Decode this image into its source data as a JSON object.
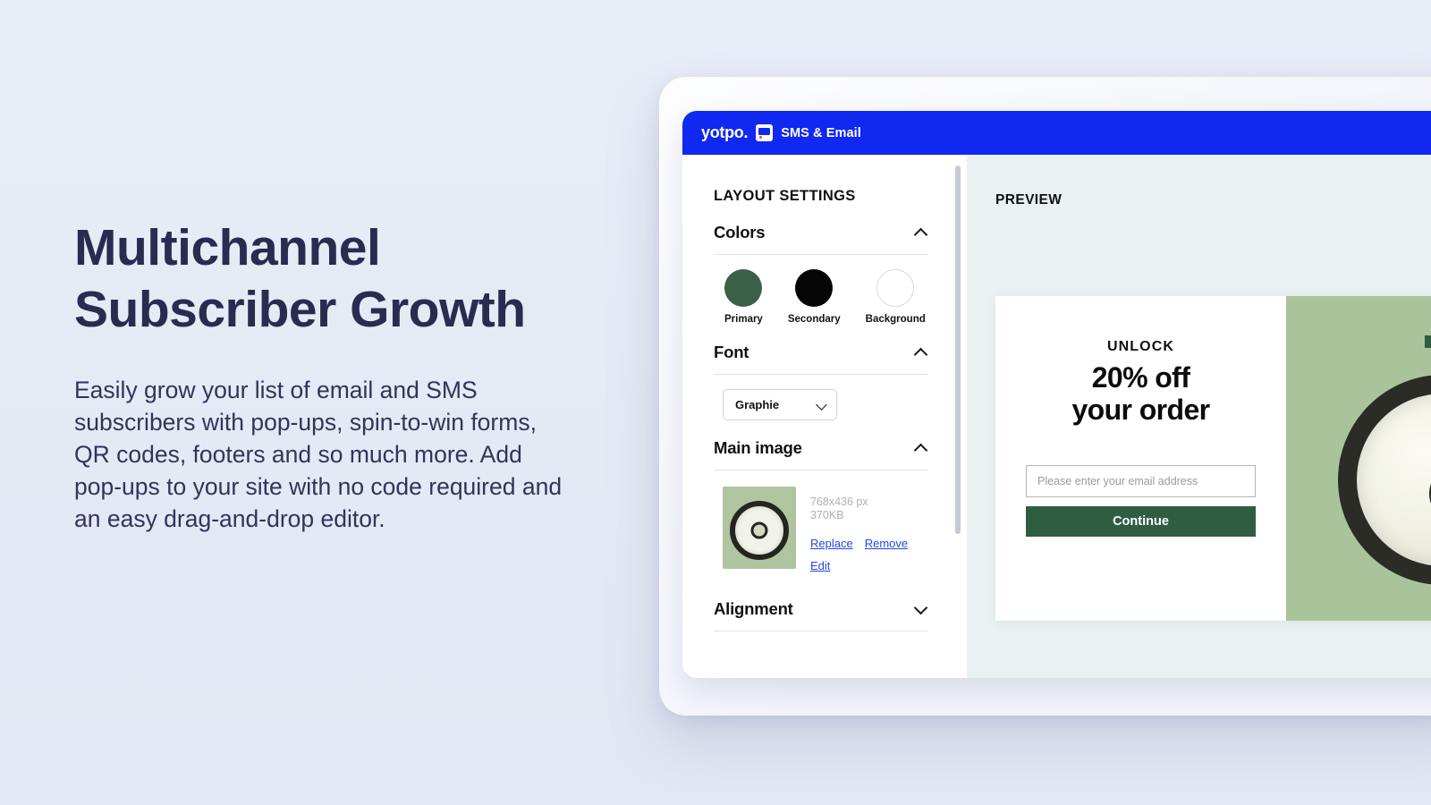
{
  "marketing": {
    "headline": "Multichannel\nSubscriber Growth",
    "body": "Easily grow your list of email and SMS subscribers with pop-ups, spin-to-win forms, QR codes, footers and so much more. Add pop-ups to your site with no code required and an easy drag-and-drop editor.",
    "headline_color": "#2b2b50",
    "background_color": "#e7ebf6"
  },
  "app": {
    "topbar": {
      "wordmark": "yotpo.",
      "product": "SMS & Email",
      "badge_icon": "yotpo-mark-icon",
      "background_color": "#1028f0"
    },
    "settings": {
      "panel_title": "LAYOUT SETTINGS",
      "sections": [
        {
          "title": "Colors",
          "expanded": true,
          "chevron": "chevron-up-icon",
          "swatches": [
            {
              "label": "Primary",
              "color": "#3a6048"
            },
            {
              "label": "Secondary",
              "color": "#050505"
            },
            {
              "label": "Background",
              "color": "#ffffff"
            }
          ]
        },
        {
          "title": "Font",
          "expanded": true,
          "chevron": "chevron-up-icon",
          "select": {
            "value": "Graphie",
            "chevron": "chevron-down-icon",
            "options": [
              "Graphie"
            ]
          }
        },
        {
          "title": "Main image",
          "expanded": true,
          "chevron": "chevron-up-icon",
          "image": {
            "dimensions": "768x436 px",
            "filesize": "370KB",
            "actions": [
              "Replace",
              "Remove",
              "Edit"
            ],
            "link_color": "#2347e3"
          }
        },
        {
          "title": "Alignment",
          "expanded": false,
          "chevron": "chevron-down-icon"
        }
      ],
      "scrollbar": {
        "visible": true
      }
    },
    "preview": {
      "title": "PREVIEW",
      "background_color": "#eaf1f2",
      "popup": {
        "kicker": "UNLOCK",
        "headline": "20% off\nyour order",
        "email_placeholder": "Please enter your email address",
        "email_value": "",
        "button_label": "Continue",
        "button_color": "#2f5d42",
        "image_background_color": "#a9c49b"
      }
    }
  }
}
